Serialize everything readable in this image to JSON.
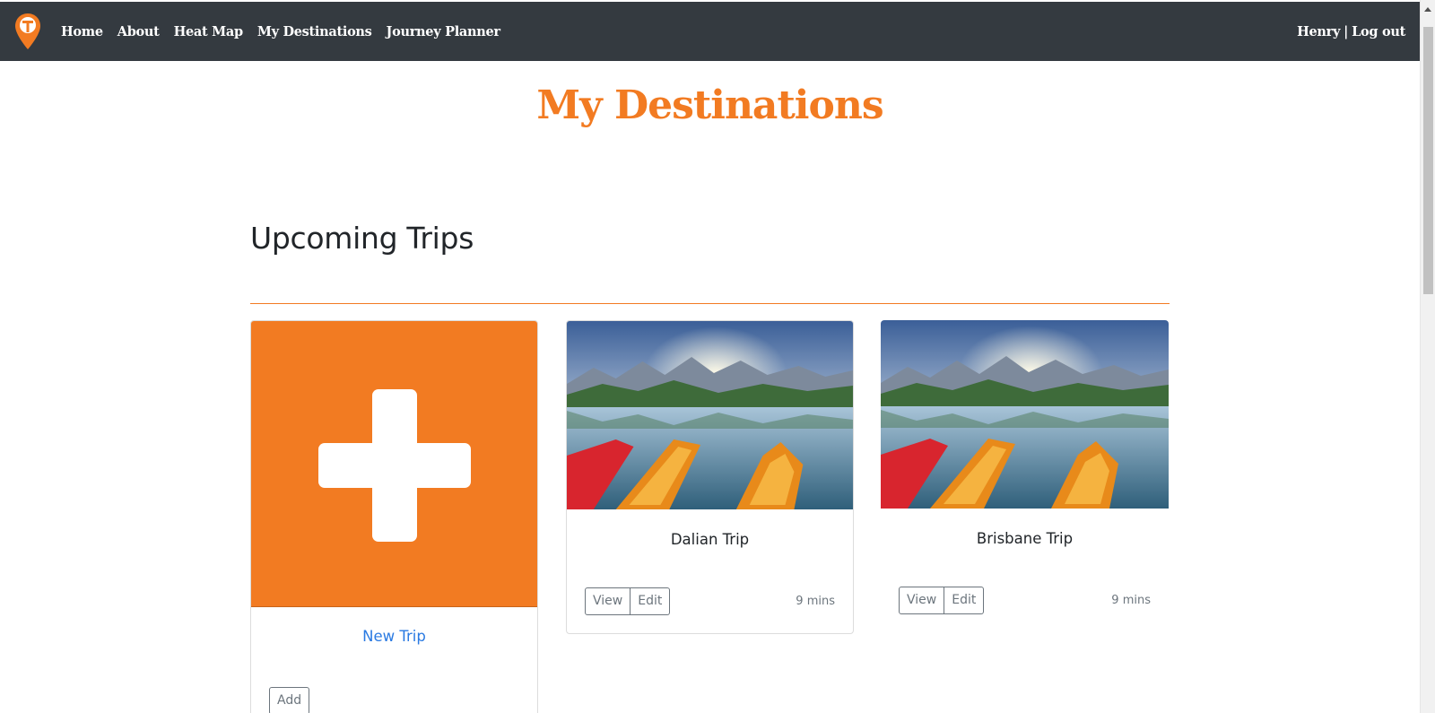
{
  "nav": {
    "logo_icon": "map-pin-logo-icon",
    "links": [
      "Home",
      "About",
      "Heat Map",
      "My Destinations",
      "Journey Planner"
    ],
    "user": "Henry",
    "separator": "|",
    "logout": "Log out"
  },
  "page": {
    "title": "My Destinations",
    "section_title": "Upcoming Trips"
  },
  "colors": {
    "accent": "#f27b22",
    "navbar": "#343a40",
    "link": "#2a7ae2"
  },
  "cards": {
    "new_trip": {
      "icon": "plus-icon",
      "title": "New Trip",
      "add_label": "Add"
    },
    "trips": [
      {
        "title": "Dalian Trip",
        "view_label": "View",
        "edit_label": "Edit",
        "time": "9 mins"
      },
      {
        "title": "Brisbane Trip",
        "view_label": "View",
        "edit_label": "Edit",
        "time": "9 mins"
      }
    ]
  }
}
